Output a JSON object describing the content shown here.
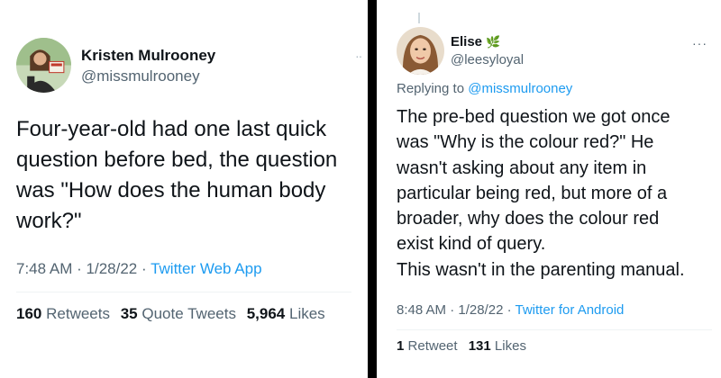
{
  "left_tweet": {
    "author_name": "Kristen Mulrooney",
    "author_handle": "@missmulrooney",
    "text_lines": [
      "Four-year-old had one last quick",
      "question before bed, the question",
      "was \"How does the human body",
      "work?\""
    ],
    "time": "7:48 AM",
    "date": "1/28/22",
    "separator": "·",
    "source": "Twitter Web App",
    "stats": {
      "retweets_count": "160",
      "retweets_label": "Retweets",
      "quotes_count": "35",
      "quotes_label": "Quote Tweets",
      "likes_count": "5,964",
      "likes_label": "Likes"
    }
  },
  "right_tweet": {
    "author_name": "Elise",
    "name_emoji": "🌿",
    "author_handle": "@leesyloyal",
    "more_icon_glyph": "···",
    "reply_prefix": "Replying to",
    "reply_handle": "@missmulrooney",
    "text_lines": [
      "The pre-bed question we got once",
      "was \"Why is the colour red?\" He",
      "wasn't asking about any item in",
      "particular being red, but more of a",
      "broader, why does the colour red",
      "exist kind of query.",
      "This wasn't in the parenting manual."
    ],
    "time": "8:48 AM",
    "date": "1/28/22",
    "separator": "·",
    "source": "Twitter for Android",
    "stats": {
      "retweets_count": "1",
      "retweets_label": "Retweet",
      "likes_count": "131",
      "likes_label": "Likes"
    }
  },
  "colors": {
    "link_blue": "#1d9bf0",
    "text_primary": "#0f1419",
    "text_secondary": "#536471",
    "divider": "#000000"
  }
}
